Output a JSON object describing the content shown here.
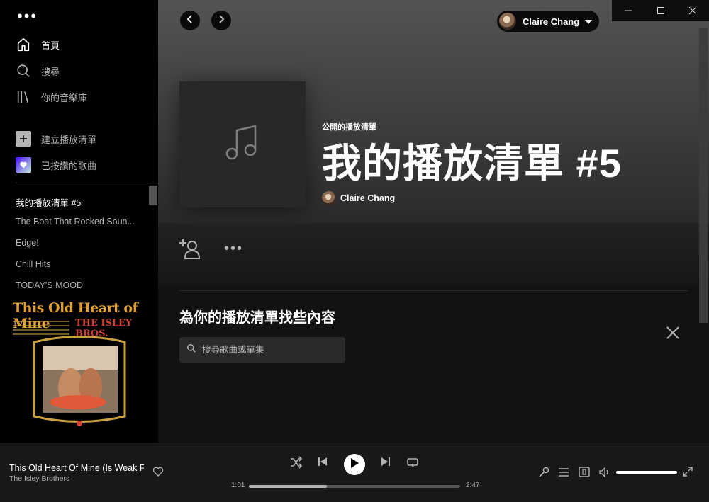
{
  "sidebar": {
    "nav": [
      {
        "label": "首頁",
        "icon": "home-icon"
      },
      {
        "label": "搜尋",
        "icon": "search-icon"
      },
      {
        "label": "你的音樂庫",
        "icon": "library-icon"
      }
    ],
    "actions": [
      {
        "label": "建立播放清單",
        "icon": "plus-icon"
      },
      {
        "label": "已按讚的歌曲",
        "icon": "heart-icon"
      }
    ],
    "playlists": [
      "我的播放清單 #5",
      "The Boat That Rocked Soun...",
      "Edge!",
      "Chill Hits",
      "TODAY'S MOOD"
    ],
    "now_playing_cover": {
      "line1": "This Old Heart of Mine",
      "line2": "THE ISLEY BROS."
    }
  },
  "header": {
    "user_name": "Claire Chang"
  },
  "playlist": {
    "type_label": "公開的播放清單",
    "title": "我的播放清單 #5",
    "owner": "Claire Chang"
  },
  "find": {
    "title": "為你的播放清單找些內容",
    "search_placeholder": "搜尋歌曲或單集"
  },
  "player": {
    "track_title": "This Old Heart Of Mine (Is Weak For You)",
    "artist": "The Isley Brothers",
    "elapsed": "1:01",
    "duration": "2:47",
    "progress": 0.37,
    "volume": 1.0
  }
}
